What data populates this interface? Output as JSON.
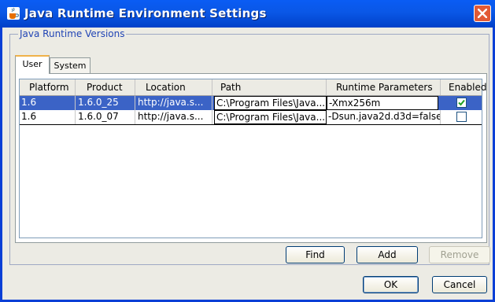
{
  "window": {
    "title": "Java Runtime Environment Settings",
    "icon": "java-cup-icon",
    "close_icon": "close-icon",
    "close_color": "#e25a36",
    "titlebar_color": "#0a57e6"
  },
  "group": {
    "title": "Java Runtime Versions"
  },
  "tabs": [
    {
      "label": "User",
      "active": true
    },
    {
      "label": "System",
      "active": false
    }
  ],
  "table": {
    "columns": [
      "Platform",
      "Product",
      "Location",
      "Path",
      "Runtime Parameters",
      "Enabled"
    ],
    "rows": [
      {
        "platform": "1.6",
        "product": "1.6.0_25",
        "location": "http://java.s...",
        "path": "C:\\Program Files\\Java...",
        "params": "-Xmx256m",
        "enabled": true,
        "selected": true
      },
      {
        "platform": "1.6",
        "product": "1.6.0_07",
        "location": "http://java.s...",
        "path": "C:\\Program Files\\Java...",
        "params": "-Dsun.java2d.d3d=false",
        "enabled": false,
        "selected": false
      }
    ],
    "selection_color": "#3b63c6"
  },
  "buttons": {
    "find": "Find",
    "add": "Add",
    "remove": "Remove",
    "ok": "OK",
    "cancel": "Cancel"
  }
}
